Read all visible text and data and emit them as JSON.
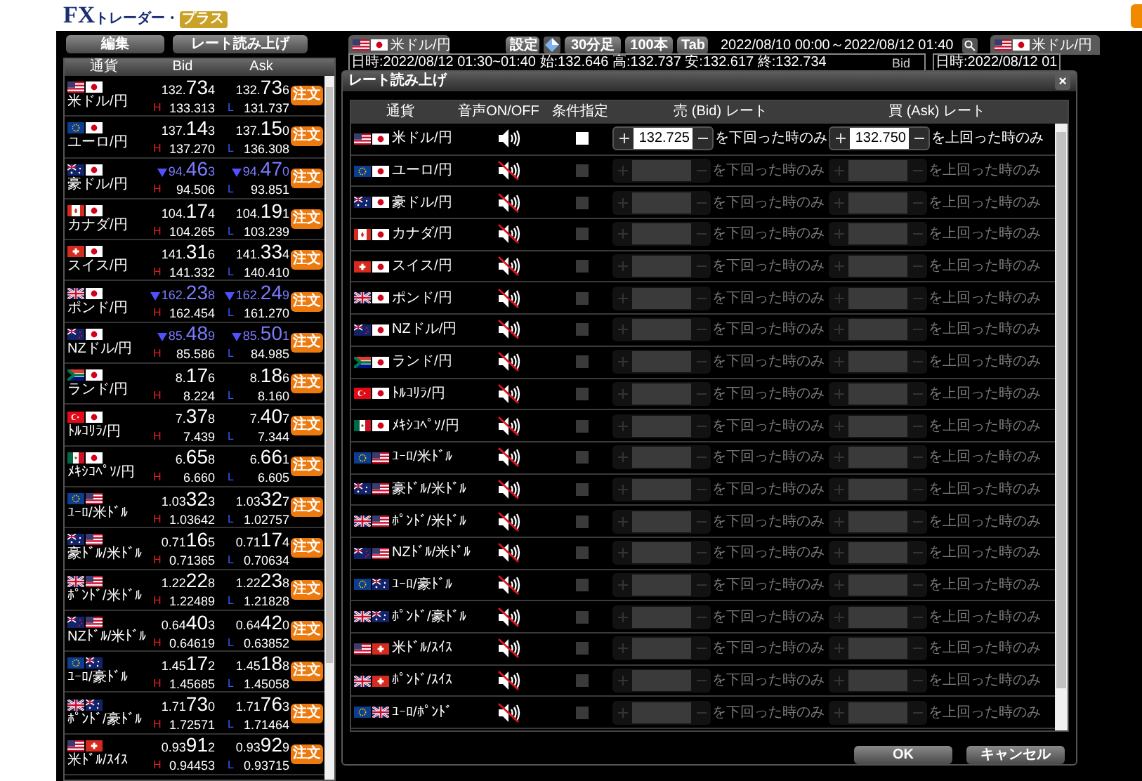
{
  "logo": {
    "brand": "FX",
    "sub": "トレーダー・",
    "badge": "プラス"
  },
  "toolbar": [
    "編集",
    "レート読み上げ"
  ],
  "rate_list": {
    "columns": [
      "通貨",
      "Bid",
      "Ask"
    ],
    "rows": [
      {
        "flags": [
          {
            "kind": "us"
          },
          {
            "kind": "jp"
          }
        ],
        "pair": "米ドル/円",
        "falling": false,
        "bid": [
          "132.",
          "73",
          "4"
        ],
        "ask": [
          "132.",
          "73",
          "6"
        ],
        "high_mark": "H",
        "high": "133.313",
        "low_mark": "L",
        "low": "131.737",
        "order": "注文"
      },
      {
        "flags": [
          {
            "kind": "eu"
          },
          {
            "kind": "jp"
          }
        ],
        "pair": "ユーロ/円",
        "falling": false,
        "bid": [
          "137.",
          "14",
          "3"
        ],
        "ask": [
          "137.",
          "15",
          "0"
        ],
        "high_mark": "H",
        "high": "137.270",
        "low_mark": "L",
        "low": "136.308",
        "order": "注文"
      },
      {
        "flags": [
          {
            "kind": "au"
          },
          {
            "kind": "jp"
          }
        ],
        "pair": "豪ドル/円",
        "falling": true,
        "bid": [
          "94.",
          "46",
          "3"
        ],
        "ask": [
          "94.",
          "47",
          "0"
        ],
        "high_mark": "H",
        "high": "94.506",
        "low_mark": "L",
        "low": "93.851",
        "order": "注文"
      },
      {
        "flags": [
          {
            "kind": "ca"
          },
          {
            "kind": "jp"
          }
        ],
        "pair": "カナダ/円",
        "falling": false,
        "bid": [
          "104.",
          "17",
          "4"
        ],
        "ask": [
          "104.",
          "19",
          "1"
        ],
        "high_mark": "H",
        "high": "104.265",
        "low_mark": "L",
        "low": "103.239",
        "order": "注文"
      },
      {
        "flags": [
          {
            "kind": "ch"
          },
          {
            "kind": "jp"
          }
        ],
        "pair": "スイス/円",
        "falling": false,
        "bid": [
          "141.",
          "31",
          "6"
        ],
        "ask": [
          "141.",
          "33",
          "4"
        ],
        "high_mark": "H",
        "high": "141.332",
        "low_mark": "L",
        "low": "140.410",
        "order": "注文"
      },
      {
        "flags": [
          {
            "kind": "gb"
          },
          {
            "kind": "jp"
          }
        ],
        "pair": "ポンド/円",
        "falling": true,
        "bid": [
          "162.",
          "23",
          "8"
        ],
        "ask": [
          "162.",
          "24",
          "9"
        ],
        "high_mark": "H",
        "high": "162.454",
        "low_mark": "L",
        "low": "161.270",
        "order": "注文"
      },
      {
        "flags": [
          {
            "kind": "nz"
          },
          {
            "kind": "jp"
          }
        ],
        "pair": "NZドル/円",
        "falling": true,
        "bid": [
          "85.",
          "48",
          "9"
        ],
        "ask": [
          "85.",
          "50",
          "1"
        ],
        "high_mark": "H",
        "high": "85.586",
        "low_mark": "L",
        "low": "84.985",
        "order": "注文"
      },
      {
        "flags": [
          {
            "kind": "za"
          },
          {
            "kind": "jp"
          }
        ],
        "pair": "ランド/円",
        "falling": false,
        "bid": [
          "8.",
          "17",
          "6"
        ],
        "ask": [
          "8.",
          "18",
          "6"
        ],
        "high_mark": "H",
        "high": "8.224",
        "low_mark": "L",
        "low": "8.160",
        "order": "注文"
      },
      {
        "flags": [
          {
            "kind": "tr"
          },
          {
            "kind": "jp"
          }
        ],
        "pair": "ﾄﾙｺﾘﾗ/円",
        "falling": false,
        "bid": [
          "7.",
          "37",
          "8"
        ],
        "ask": [
          "7.",
          "40",
          "7"
        ],
        "high_mark": "H",
        "high": "7.439",
        "low_mark": "L",
        "low": "7.344",
        "order": "注文"
      },
      {
        "flags": [
          {
            "kind": "mx"
          },
          {
            "kind": "jp"
          }
        ],
        "pair": "ﾒｷｼｺﾍﾟｿ/円",
        "falling": false,
        "bid": [
          "6.",
          "65",
          "8"
        ],
        "ask": [
          "6.",
          "66",
          "1"
        ],
        "high_mark": "H",
        "high": "6.660",
        "low_mark": "L",
        "low": "6.605",
        "order": "注文"
      },
      {
        "flags": [
          {
            "kind": "eu"
          },
          {
            "kind": "us"
          }
        ],
        "pair": "ﾕｰﾛ/米ﾄﾞﾙ",
        "falling": false,
        "bid": [
          "1.03",
          "32",
          "3"
        ],
        "ask": [
          "1.03",
          "32",
          "7"
        ],
        "high_mark": "H",
        "high": "1.03642",
        "low_mark": "L",
        "low": "1.02757",
        "order": "注文"
      },
      {
        "flags": [
          {
            "kind": "au"
          },
          {
            "kind": "us"
          }
        ],
        "pair": "豪ﾄﾞﾙ/米ﾄﾞﾙ",
        "falling": false,
        "bid": [
          "0.71",
          "16",
          "5"
        ],
        "ask": [
          "0.71",
          "17",
          "4"
        ],
        "high_mark": "H",
        "high": "0.71365",
        "low_mark": "L",
        "low": "0.70634",
        "order": "注文"
      },
      {
        "flags": [
          {
            "kind": "gb"
          },
          {
            "kind": "us"
          }
        ],
        "pair": "ﾎﾟﾝﾄﾞ/米ﾄﾞﾙ",
        "falling": false,
        "bid": [
          "1.22",
          "22",
          "8"
        ],
        "ask": [
          "1.22",
          "23",
          "8"
        ],
        "high_mark": "H",
        "high": "1.22489",
        "low_mark": "L",
        "low": "1.21828",
        "order": "注文"
      },
      {
        "flags": [
          {
            "kind": "nz"
          },
          {
            "kind": "us"
          }
        ],
        "pair": "NZﾄﾞﾙ/米ﾄﾞﾙ",
        "falling": false,
        "bid": [
          "0.64",
          "40",
          "3"
        ],
        "ask": [
          "0.64",
          "42",
          "0"
        ],
        "high_mark": "H",
        "high": "0.64619",
        "low_mark": "L",
        "low": "0.63852",
        "order": "注文"
      },
      {
        "flags": [
          {
            "kind": "eu"
          },
          {
            "kind": "au"
          }
        ],
        "pair": "ﾕｰﾛ/豪ﾄﾞﾙ",
        "falling": false,
        "bid": [
          "1.45",
          "17",
          "2"
        ],
        "ask": [
          "1.45",
          "18",
          "8"
        ],
        "high_mark": "H",
        "high": "1.45685",
        "low_mark": "L",
        "low": "1.45058",
        "order": "注文"
      },
      {
        "flags": [
          {
            "kind": "gb"
          },
          {
            "kind": "au"
          }
        ],
        "pair": "ﾎﾟﾝﾄﾞ/豪ﾄﾞﾙ",
        "falling": false,
        "bid": [
          "1.71",
          "73",
          "0"
        ],
        "ask": [
          "1.71",
          "76",
          "3"
        ],
        "high_mark": "H",
        "high": "1.72571",
        "low_mark": "L",
        "low": "1.71464",
        "order": "注文"
      },
      {
        "flags": [
          {
            "kind": "us"
          },
          {
            "kind": "ch"
          }
        ],
        "pair": "米ﾄﾞﾙ/ｽｲｽ",
        "falling": false,
        "bid": [
          "0.93",
          "91",
          "2"
        ],
        "ask": [
          "0.93",
          "92",
          "9"
        ],
        "high_mark": "H",
        "high": "0.94453",
        "low_mark": "L",
        "low": "0.93715",
        "order": "注文"
      }
    ]
  },
  "chart": {
    "tab_flags": [
      {
        "kind": "us"
      },
      {
        "kind": "jp"
      }
    ],
    "tab": "米ドル/円",
    "settings": "設定",
    "timeframe": "30分足",
    "bars": "100本",
    "tab_button": "Tab",
    "range": "2022/08/10 00:00～2022/08/12 01:40",
    "info": "日時:2022/08/12 01:30~01:40 始:132.646 高:132.737 安:132.617 終:132.734",
    "side": "Bid",
    "tab2_flags": [
      {
        "kind": "us"
      },
      {
        "kind": "jp"
      }
    ],
    "tab2": "米ドル/円",
    "info2": "日時:2022/08/12 01"
  },
  "dialog": {
    "title": "レート読み上げ",
    "close": "×",
    "columns": [
      "通貨",
      "音声ON/OFF",
      "条件指定",
      "売 (Bid) レート",
      "買 (Ask) レート"
    ],
    "rows": [
      {
        "flags": [
          {
            "kind": "us"
          },
          {
            "kind": "jp"
          }
        ],
        "pair": "米ドル/円",
        "sound_on": true,
        "checked": false,
        "disabled": false,
        "bid_value": "132.725",
        "below_label": "を下回った時のみ",
        "ask_value": "132.750",
        "above_label": "を上回った時のみ"
      },
      {
        "flags": [
          {
            "kind": "eu"
          },
          {
            "kind": "jp"
          }
        ],
        "pair": "ユーロ/円",
        "sound_on": false,
        "checked": false,
        "disabled": true,
        "below_label": "を下回った時のみ",
        "above_label": "を上回った時のみ"
      },
      {
        "flags": [
          {
            "kind": "au"
          },
          {
            "kind": "jp"
          }
        ],
        "pair": "豪ドル/円",
        "sound_on": false,
        "checked": false,
        "disabled": true,
        "below_label": "を下回った時のみ",
        "above_label": "を上回った時のみ"
      },
      {
        "flags": [
          {
            "kind": "ca"
          },
          {
            "kind": "jp"
          }
        ],
        "pair": "カナダ/円",
        "sound_on": false,
        "checked": false,
        "disabled": true,
        "below_label": "を下回った時のみ",
        "above_label": "を上回った時のみ"
      },
      {
        "flags": [
          {
            "kind": "ch"
          },
          {
            "kind": "jp"
          }
        ],
        "pair": "スイス/円",
        "sound_on": false,
        "checked": false,
        "disabled": true,
        "below_label": "を下回った時のみ",
        "above_label": "を上回った時のみ"
      },
      {
        "flags": [
          {
            "kind": "gb"
          },
          {
            "kind": "jp"
          }
        ],
        "pair": "ポンド/円",
        "sound_on": false,
        "checked": false,
        "disabled": true,
        "below_label": "を下回った時のみ",
        "above_label": "を上回った時のみ"
      },
      {
        "flags": [
          {
            "kind": "nz"
          },
          {
            "kind": "jp"
          }
        ],
        "pair": "NZドル/円",
        "sound_on": false,
        "checked": false,
        "disabled": true,
        "below_label": "を下回った時のみ",
        "above_label": "を上回った時のみ"
      },
      {
        "flags": [
          {
            "kind": "za"
          },
          {
            "kind": "jp"
          }
        ],
        "pair": "ランド/円",
        "sound_on": false,
        "checked": false,
        "disabled": true,
        "below_label": "を下回った時のみ",
        "above_label": "を上回った時のみ"
      },
      {
        "flags": [
          {
            "kind": "tr"
          },
          {
            "kind": "jp"
          }
        ],
        "pair": "ﾄﾙｺﾘﾗ/円",
        "sound_on": false,
        "checked": false,
        "disabled": true,
        "below_label": "を下回った時のみ",
        "above_label": "を上回った時のみ"
      },
      {
        "flags": [
          {
            "kind": "mx"
          },
          {
            "kind": "jp"
          }
        ],
        "pair": "ﾒｷｼｺﾍﾟｿ/円",
        "sound_on": false,
        "checked": false,
        "disabled": true,
        "below_label": "を下回った時のみ",
        "above_label": "を上回った時のみ"
      },
      {
        "flags": [
          {
            "kind": "eu"
          },
          {
            "kind": "us"
          }
        ],
        "pair": "ﾕｰﾛ/米ﾄﾞﾙ",
        "sound_on": false,
        "checked": false,
        "disabled": true,
        "below_label": "を下回った時のみ",
        "above_label": "を上回った時のみ"
      },
      {
        "flags": [
          {
            "kind": "au"
          },
          {
            "kind": "us"
          }
        ],
        "pair": "豪ﾄﾞﾙ/米ﾄﾞﾙ",
        "sound_on": false,
        "checked": false,
        "disabled": true,
        "below_label": "を下回った時のみ",
        "above_label": "を上回った時のみ"
      },
      {
        "flags": [
          {
            "kind": "gb"
          },
          {
            "kind": "us"
          }
        ],
        "pair": "ﾎﾟﾝﾄﾞ/米ﾄﾞﾙ",
        "sound_on": false,
        "checked": false,
        "disabled": true,
        "below_label": "を下回った時のみ",
        "above_label": "を上回った時のみ"
      },
      {
        "flags": [
          {
            "kind": "nz"
          },
          {
            "kind": "us"
          }
        ],
        "pair": "NZﾄﾞﾙ/米ﾄﾞﾙ",
        "sound_on": false,
        "checked": false,
        "disabled": true,
        "below_label": "を下回った時のみ",
        "above_label": "を上回った時のみ"
      },
      {
        "flags": [
          {
            "kind": "eu"
          },
          {
            "kind": "au"
          }
        ],
        "pair": "ﾕｰﾛ/豪ﾄﾞﾙ",
        "sound_on": false,
        "checked": false,
        "disabled": true,
        "below_label": "を下回った時のみ",
        "above_label": "を上回った時のみ"
      },
      {
        "flags": [
          {
            "kind": "gb"
          },
          {
            "kind": "au"
          }
        ],
        "pair": "ﾎﾟﾝﾄﾞ/豪ﾄﾞﾙ",
        "sound_on": false,
        "checked": false,
        "disabled": true,
        "below_label": "を下回った時のみ",
        "above_label": "を上回った時のみ"
      },
      {
        "flags": [
          {
            "kind": "us"
          },
          {
            "kind": "ch"
          }
        ],
        "pair": "米ﾄﾞﾙ/ｽｲｽ",
        "sound_on": false,
        "checked": false,
        "disabled": true,
        "below_label": "を下回った時のみ",
        "above_label": "を上回った時のみ"
      },
      {
        "flags": [
          {
            "kind": "gb"
          },
          {
            "kind": "ch"
          }
        ],
        "pair": "ﾎﾟﾝﾄﾞ/ｽｲｽ",
        "sound_on": false,
        "checked": false,
        "disabled": true,
        "below_label": "を下回った時のみ",
        "above_label": "を上回った時のみ"
      },
      {
        "flags": [
          {
            "kind": "eu"
          },
          {
            "kind": "gb"
          }
        ],
        "pair": "ﾕｰﾛ/ﾎﾟﾝﾄﾞ",
        "sound_on": false,
        "checked": false,
        "disabled": true,
        "below_label": "を下回った時のみ",
        "above_label": "を上回った時のみ"
      }
    ],
    "buttons": [
      "OK",
      "キャンセル"
    ]
  }
}
